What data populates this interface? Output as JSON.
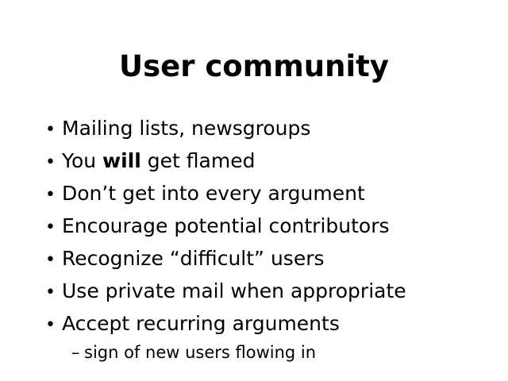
{
  "slide": {
    "title": "User community",
    "bullets": [
      {
        "text": "Mailing lists, newsgroups"
      },
      {
        "before": "You ",
        "bold": "will",
        "after": " get flamed"
      },
      {
        "text": "Don’t get into every argument"
      },
      {
        "text": "Encourage potential contributors"
      },
      {
        "text": "Recognize “difficult” users"
      },
      {
        "text": "Use private mail when appropriate"
      },
      {
        "text": "Accept recurring arguments"
      }
    ],
    "sub_bullet": "sign of new users flowing in",
    "bullet_symbol": "•",
    "sub_bullet_symbol": "–"
  }
}
